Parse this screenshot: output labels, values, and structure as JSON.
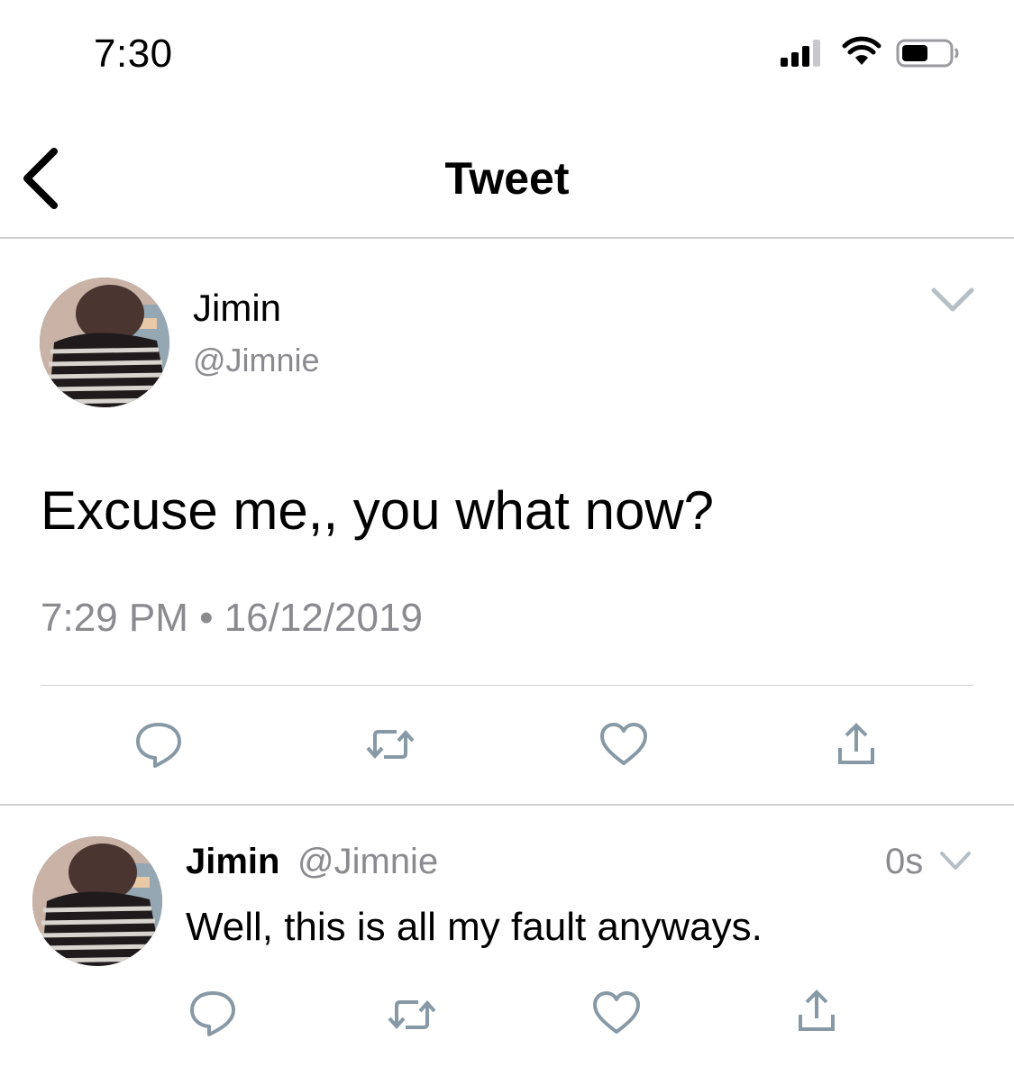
{
  "status_bar": {
    "time": "7:30",
    "icons": [
      "cellular-signal-icon",
      "wifi-icon",
      "battery-icon"
    ]
  },
  "nav": {
    "title": "Tweet",
    "back_icon": "chevron-left-icon"
  },
  "main_tweet": {
    "author_name": "Jimin",
    "author_handle": "@Jimnie",
    "text": "Excuse me,, you what now?",
    "timestamp": "7:29 PM • 16/12/2019",
    "menu_icon": "chevron-down-icon",
    "actions": [
      "reply-icon",
      "retweet-icon",
      "like-icon",
      "share-icon"
    ]
  },
  "reply": {
    "author_name": "Jimin",
    "author_handle": "@Jimnie",
    "age": "0s",
    "text": "Well, this is all my fault anyways.",
    "menu_icon": "chevron-down-icon",
    "actions": [
      "reply-icon",
      "retweet-icon",
      "like-icon",
      "share-icon"
    ]
  },
  "colors": {
    "text": "#000000",
    "secondary_text": "#8a8a8f",
    "icon_gray": "#8899a6",
    "divider": "#cfcfd4",
    "background": "#ffffff"
  }
}
